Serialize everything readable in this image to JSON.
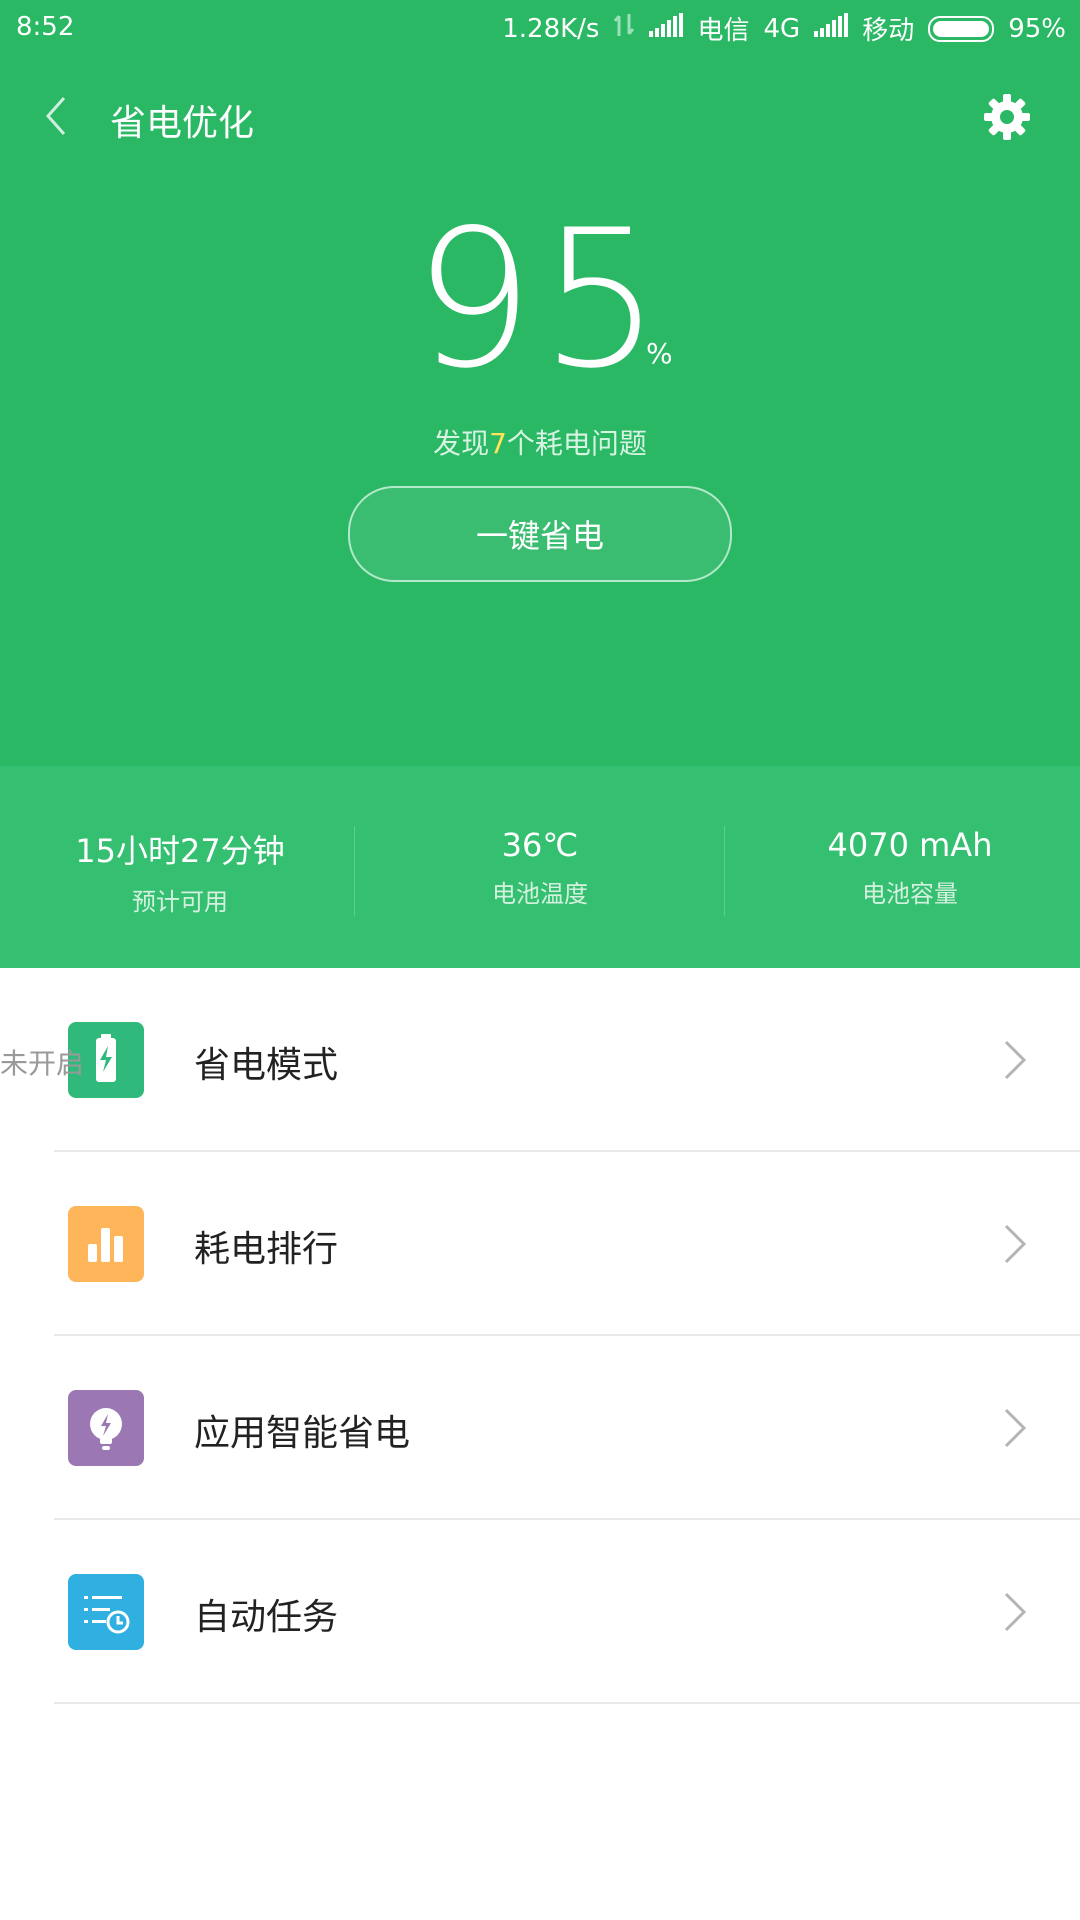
{
  "status_bar": {
    "time": "8:52",
    "net_speed": "1.28K/s",
    "carrier1": "电信",
    "carrier1_net": "4G",
    "carrier2": "移动",
    "battery_text": "95%"
  },
  "header": {
    "title": "省电优化"
  },
  "battery": {
    "level": "95",
    "unit": "%",
    "issues_prefix": "发现",
    "issues_count": "7",
    "issues_suffix": "个耗电问题",
    "button_label": "一键省电"
  },
  "stats": [
    {
      "value": "15小时27分钟",
      "label": "预计可用"
    },
    {
      "value": "36℃",
      "label": "电池温度"
    },
    {
      "value": "4070 mAh",
      "label": "电池容量"
    }
  ],
  "menu": [
    {
      "label": "省电模式",
      "status": "未开启",
      "icon": "battery-bolt-icon",
      "color": "#2fba7c"
    },
    {
      "label": "耗电排行",
      "status": "",
      "icon": "bar-chart-icon",
      "color": "#ffb55a"
    },
    {
      "label": "应用智能省电",
      "status": "",
      "icon": "bulb-bolt-icon",
      "color": "#9b77b4"
    },
    {
      "label": "自动任务",
      "status": "",
      "icon": "task-clock-icon",
      "color": "#2fb0e0"
    }
  ],
  "colors": {
    "primary_green": "#2ab865",
    "stats_band": "#35bf70",
    "highlight_yellow": "#ffe45c"
  }
}
